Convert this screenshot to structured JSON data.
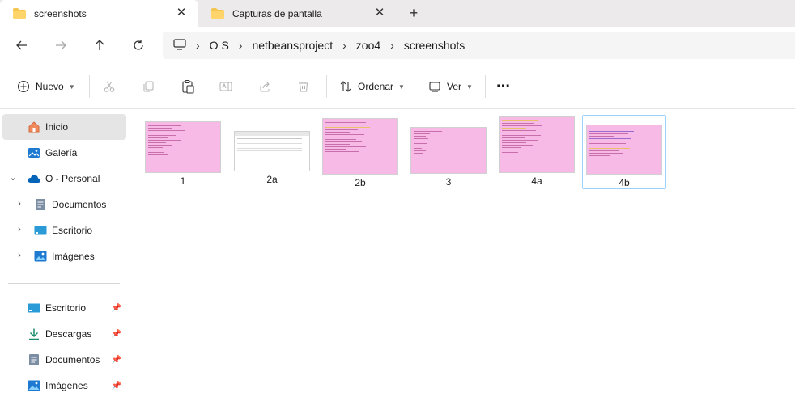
{
  "tabs": [
    {
      "label": "screenshots",
      "active": true
    },
    {
      "label": "Capturas de pantalla",
      "active": false
    }
  ],
  "address": {
    "crumbs": [
      "O S",
      "netbeansproject",
      "zoo4",
      "screenshots"
    ]
  },
  "toolbar": {
    "new_label": "Nuevo",
    "sort_label": "Ordenar",
    "view_label": "Ver",
    "more_label": "···"
  },
  "sidebar": {
    "top_items": [
      {
        "label": "Inicio",
        "icon": "home-icon"
      },
      {
        "label": "Galería",
        "icon": "gallery-icon"
      },
      {
        "label": "O - Personal",
        "icon": "cloud-icon"
      },
      {
        "label": "Documentos",
        "icon": "documents-icon"
      },
      {
        "label": "Escritorio",
        "icon": "desktop-icon"
      },
      {
        "label": "Imágenes",
        "icon": "pictures-icon"
      }
    ],
    "pinned_items": [
      {
        "label": "Escritorio",
        "icon": "desktop-icon"
      },
      {
        "label": "Descargas",
        "icon": "downloads-icon"
      },
      {
        "label": "Documentos",
        "icon": "documents-icon"
      },
      {
        "label": "Imágenes",
        "icon": "pictures-icon"
      }
    ]
  },
  "files": [
    {
      "name": "1"
    },
    {
      "name": "2a"
    },
    {
      "name": "2b"
    },
    {
      "name": "3"
    },
    {
      "name": "4a"
    },
    {
      "name": "4b"
    }
  ],
  "colors": {
    "accent": "#0067c0",
    "folder": "#f3c74f",
    "thumb_pink": "#f7b9e5",
    "selection_border": "#99d1ff"
  }
}
